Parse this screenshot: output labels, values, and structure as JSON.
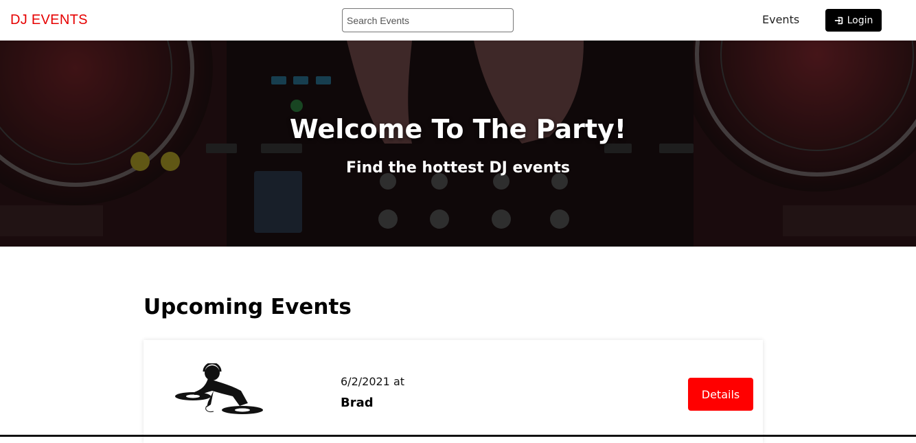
{
  "header": {
    "logo": "DJ EVENTS",
    "search_placeholder": "Search Events",
    "nav_events": "Events",
    "login_label": "Login",
    "login_icon": "sign-in-icon"
  },
  "hero": {
    "title": "Welcome To The Party!",
    "subtitle": "Find the hottest DJ events"
  },
  "main": {
    "section_title": "Upcoming Events",
    "events": [
      {
        "date": "6/2/2021 at",
        "name": "Brad",
        "details_label": "Details",
        "image_icon": "dj-silhouette-icon"
      }
    ]
  },
  "colors": {
    "brand": "#e60000",
    "details_button": "#ff0000",
    "login_button": "#000000"
  }
}
